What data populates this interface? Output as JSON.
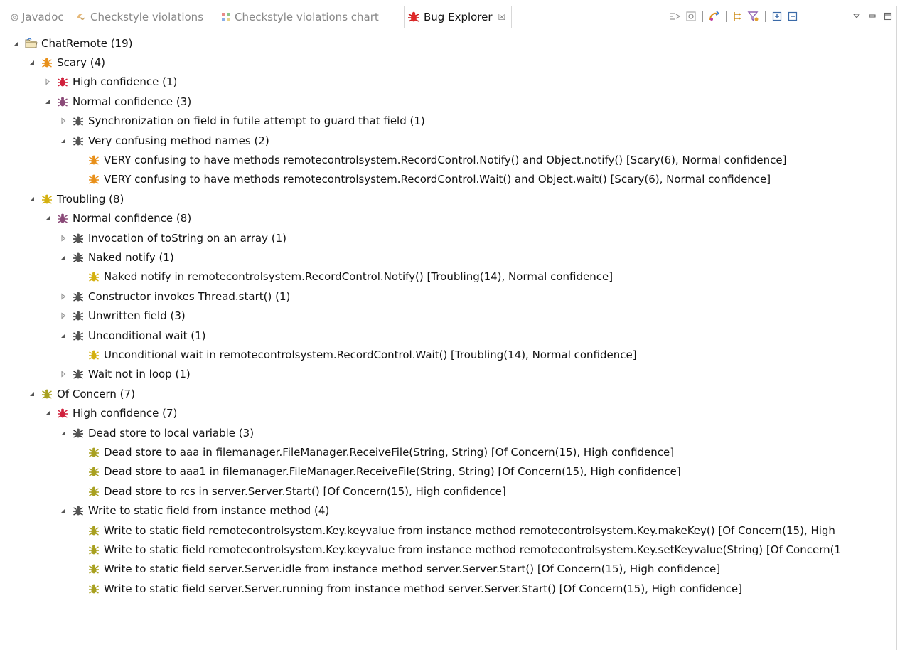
{
  "tabs": [
    {
      "label": "Javadoc",
      "icon": "at-icon"
    },
    {
      "label": "Checkstyle violations",
      "icon": "checkstyle-icon"
    },
    {
      "label": "Checkstyle violations chart",
      "icon": "chart-icon"
    },
    {
      "label": "Bug Explorer",
      "icon": "bug-icon",
      "active": true,
      "close": "☒"
    }
  ],
  "tree": [
    {
      "depth": 0,
      "expanded": true,
      "icon": "project-folder",
      "label": "ChatRemote (19)"
    },
    {
      "depth": 1,
      "expanded": true,
      "icon": "bug-orange",
      "label": "Scary (4)"
    },
    {
      "depth": 2,
      "expanded": false,
      "icon": "bug-red",
      "label": "High confidence (1)"
    },
    {
      "depth": 2,
      "expanded": true,
      "icon": "bug-purple",
      "label": "Normal confidence (3)"
    },
    {
      "depth": 3,
      "expanded": false,
      "icon": "bug-dark",
      "label": "Synchronization on field in futile attempt to guard that field (1)"
    },
    {
      "depth": 3,
      "expanded": true,
      "icon": "bug-dark",
      "label": "Very confusing method names (2)"
    },
    {
      "depth": 4,
      "leaf": true,
      "icon": "bug-orange",
      "label": "VERY confusing to have methods remotecontrolsystem.RecordControl.Notify() and Object.notify() [Scary(6), Normal confidence]"
    },
    {
      "depth": 4,
      "leaf": true,
      "icon": "bug-orange",
      "label": "VERY confusing to have methods remotecontrolsystem.RecordControl.Wait() and Object.wait() [Scary(6), Normal confidence]"
    },
    {
      "depth": 1,
      "expanded": true,
      "icon": "bug-yellow",
      "label": "Troubling (8)"
    },
    {
      "depth": 2,
      "expanded": true,
      "icon": "bug-purple",
      "label": "Normal confidence (8)"
    },
    {
      "depth": 3,
      "expanded": false,
      "icon": "bug-dark",
      "label": "Invocation of toString on an array (1)"
    },
    {
      "depth": 3,
      "expanded": true,
      "icon": "bug-dark",
      "label": "Naked notify (1)"
    },
    {
      "depth": 4,
      "leaf": true,
      "icon": "bug-yellow",
      "label": "Naked notify in remotecontrolsystem.RecordControl.Notify() [Troubling(14), Normal confidence]"
    },
    {
      "depth": 3,
      "expanded": false,
      "icon": "bug-dark",
      "label": "Constructor invokes Thread.start() (1)"
    },
    {
      "depth": 3,
      "expanded": false,
      "icon": "bug-dark",
      "label": "Unwritten field (3)"
    },
    {
      "depth": 3,
      "expanded": true,
      "icon": "bug-dark",
      "label": "Unconditional wait (1)"
    },
    {
      "depth": 4,
      "leaf": true,
      "icon": "bug-yellow",
      "label": "Unconditional wait in remotecontrolsystem.RecordControl.Wait() [Troubling(14), Normal confidence]"
    },
    {
      "depth": 3,
      "expanded": false,
      "icon": "bug-dark",
      "label": "Wait not in loop  (1)"
    },
    {
      "depth": 1,
      "expanded": true,
      "icon": "bug-olive",
      "label": "Of Concern (7)"
    },
    {
      "depth": 2,
      "expanded": true,
      "icon": "bug-red",
      "label": "High confidence (7)"
    },
    {
      "depth": 3,
      "expanded": true,
      "icon": "bug-dark",
      "label": "Dead store to local variable (3)"
    },
    {
      "depth": 4,
      "leaf": true,
      "icon": "bug-olive",
      "label": "Dead store to aaa in filemanager.FileManager.ReceiveFile(String, String) [Of Concern(15), High confidence]"
    },
    {
      "depth": 4,
      "leaf": true,
      "icon": "bug-olive",
      "label": "Dead store to aaa1 in filemanager.FileManager.ReceiveFile(String, String) [Of Concern(15), High confidence]"
    },
    {
      "depth": 4,
      "leaf": true,
      "icon": "bug-olive",
      "label": "Dead store to rcs in server.Server.Start() [Of Concern(15), High confidence]"
    },
    {
      "depth": 3,
      "expanded": true,
      "icon": "bug-dark",
      "label": "Write to static field from instance method (4)"
    },
    {
      "depth": 4,
      "leaf": true,
      "icon": "bug-olive",
      "label": "Write to static field remotecontrolsystem.Key.keyvalue from instance method remotecontrolsystem.Key.makeKey() [Of Concern(15), High"
    },
    {
      "depth": 4,
      "leaf": true,
      "icon": "bug-olive",
      "label": "Write to static field remotecontrolsystem.Key.keyvalue from instance method remotecontrolsystem.Key.setKeyvalue(String) [Of Concern(1"
    },
    {
      "depth": 4,
      "leaf": true,
      "icon": "bug-olive",
      "label": "Write to static field server.Server.idle from instance method server.Server.Start() [Of Concern(15), High confidence]"
    },
    {
      "depth": 4,
      "leaf": true,
      "icon": "bug-olive",
      "label": "Write to static field server.Server.running from instance method server.Server.Start() [Of Concern(15), High confidence]"
    }
  ],
  "colors": {
    "orange": "#e8901a",
    "red": "#d0203c",
    "purple": "#8a4a78",
    "dark": "#555555",
    "yellow": "#d4b010",
    "olive": "#a8a020"
  }
}
